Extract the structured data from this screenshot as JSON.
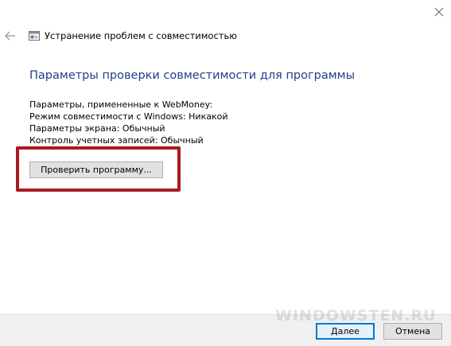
{
  "window": {
    "title": "Устранение проблем с совместимостью",
    "back_icon": "arrow-left-icon",
    "title_icon": "troubleshooter-icon",
    "close_icon": "close-icon"
  },
  "main": {
    "heading": "Параметры проверки совместимости для программы",
    "params": [
      "Параметры, примененные к  WebMoney:",
      "Режим совместимости с Windows: Никакой",
      "Параметры экрана:  Обычный",
      "Контроль учетных записей:  Обычный"
    ],
    "test_button_label": "Проверить программу..."
  },
  "footer": {
    "next_label": "Далее",
    "cancel_label": "Отмена",
    "watermark": "WINDOWSTEN.RU"
  },
  "colors": {
    "heading": "#1e3f8a",
    "highlight": "#a81a23",
    "footer_bg": "#f0f0f0",
    "accent": "#0078d7"
  }
}
